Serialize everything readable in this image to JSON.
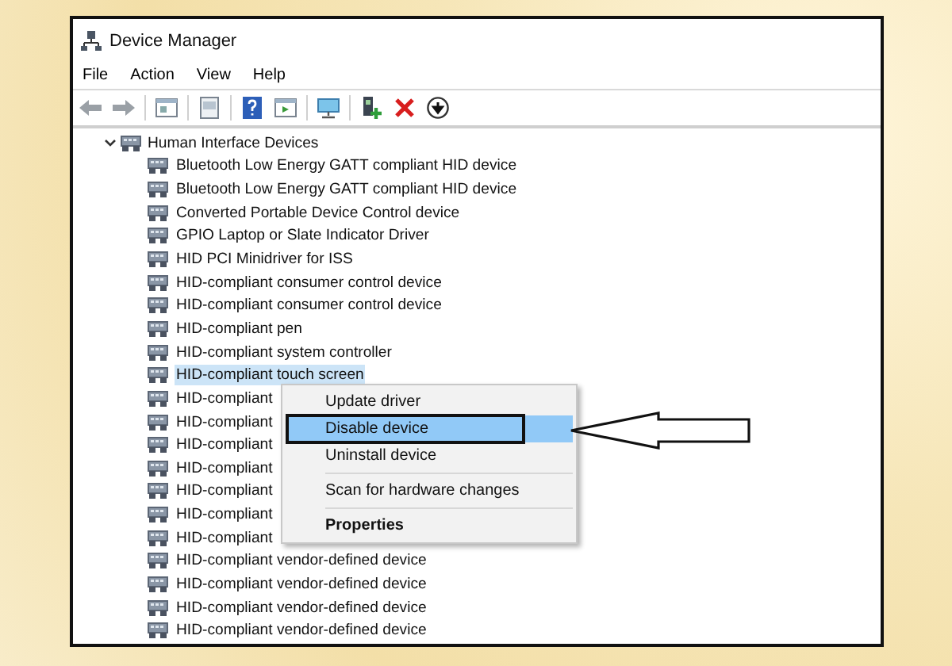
{
  "window": {
    "title": "Device Manager"
  },
  "menu_bar": [
    "File",
    "Action",
    "View",
    "Help"
  ],
  "tree": {
    "label": "Human Interface Devices",
    "expanded": true,
    "children": [
      {
        "label": "Bluetooth Low Energy GATT compliant HID device",
        "selected": false
      },
      {
        "label": "Bluetooth Low Energy GATT compliant HID device",
        "selected": false
      },
      {
        "label": "Converted Portable Device Control device",
        "selected": false
      },
      {
        "label": "GPIO Laptop or Slate Indicator Driver",
        "selected": false
      },
      {
        "label": "HID PCI Minidriver for ISS",
        "selected": false
      },
      {
        "label": "HID-compliant consumer control device",
        "selected": false
      },
      {
        "label": "HID-compliant consumer control device",
        "selected": false
      },
      {
        "label": "HID-compliant pen",
        "selected": false
      },
      {
        "label": "HID-compliant system controller",
        "selected": false
      },
      {
        "label": "HID-compliant touch screen",
        "selected": true
      },
      {
        "label": "HID-compliant",
        "selected": false
      },
      {
        "label": "HID-compliant",
        "selected": false
      },
      {
        "label": "HID-compliant",
        "selected": false
      },
      {
        "label": "HID-compliant",
        "selected": false
      },
      {
        "label": "HID-compliant",
        "selected": false
      },
      {
        "label": "HID-compliant",
        "selected": false
      },
      {
        "label": "HID-compliant",
        "selected": false
      },
      {
        "label": "HID-compliant vendor-defined device",
        "selected": false
      },
      {
        "label": "HID-compliant vendor-defined device",
        "selected": false
      },
      {
        "label": "HID-compliant vendor-defined device",
        "selected": false
      },
      {
        "label": "HID-compliant vendor-defined device",
        "selected": false
      }
    ]
  },
  "context_menu": [
    {
      "kind": "item",
      "label": "Update driver",
      "selected": false
    },
    {
      "kind": "item",
      "label": "Disable device",
      "selected": true
    },
    {
      "kind": "item",
      "label": "Uninstall device",
      "selected": false
    },
    {
      "kind": "separator"
    },
    {
      "kind": "item",
      "label": "Scan for hardware changes",
      "selected": false
    },
    {
      "kind": "separator"
    },
    {
      "kind": "default",
      "label": "Properties",
      "selected": false
    }
  ]
}
